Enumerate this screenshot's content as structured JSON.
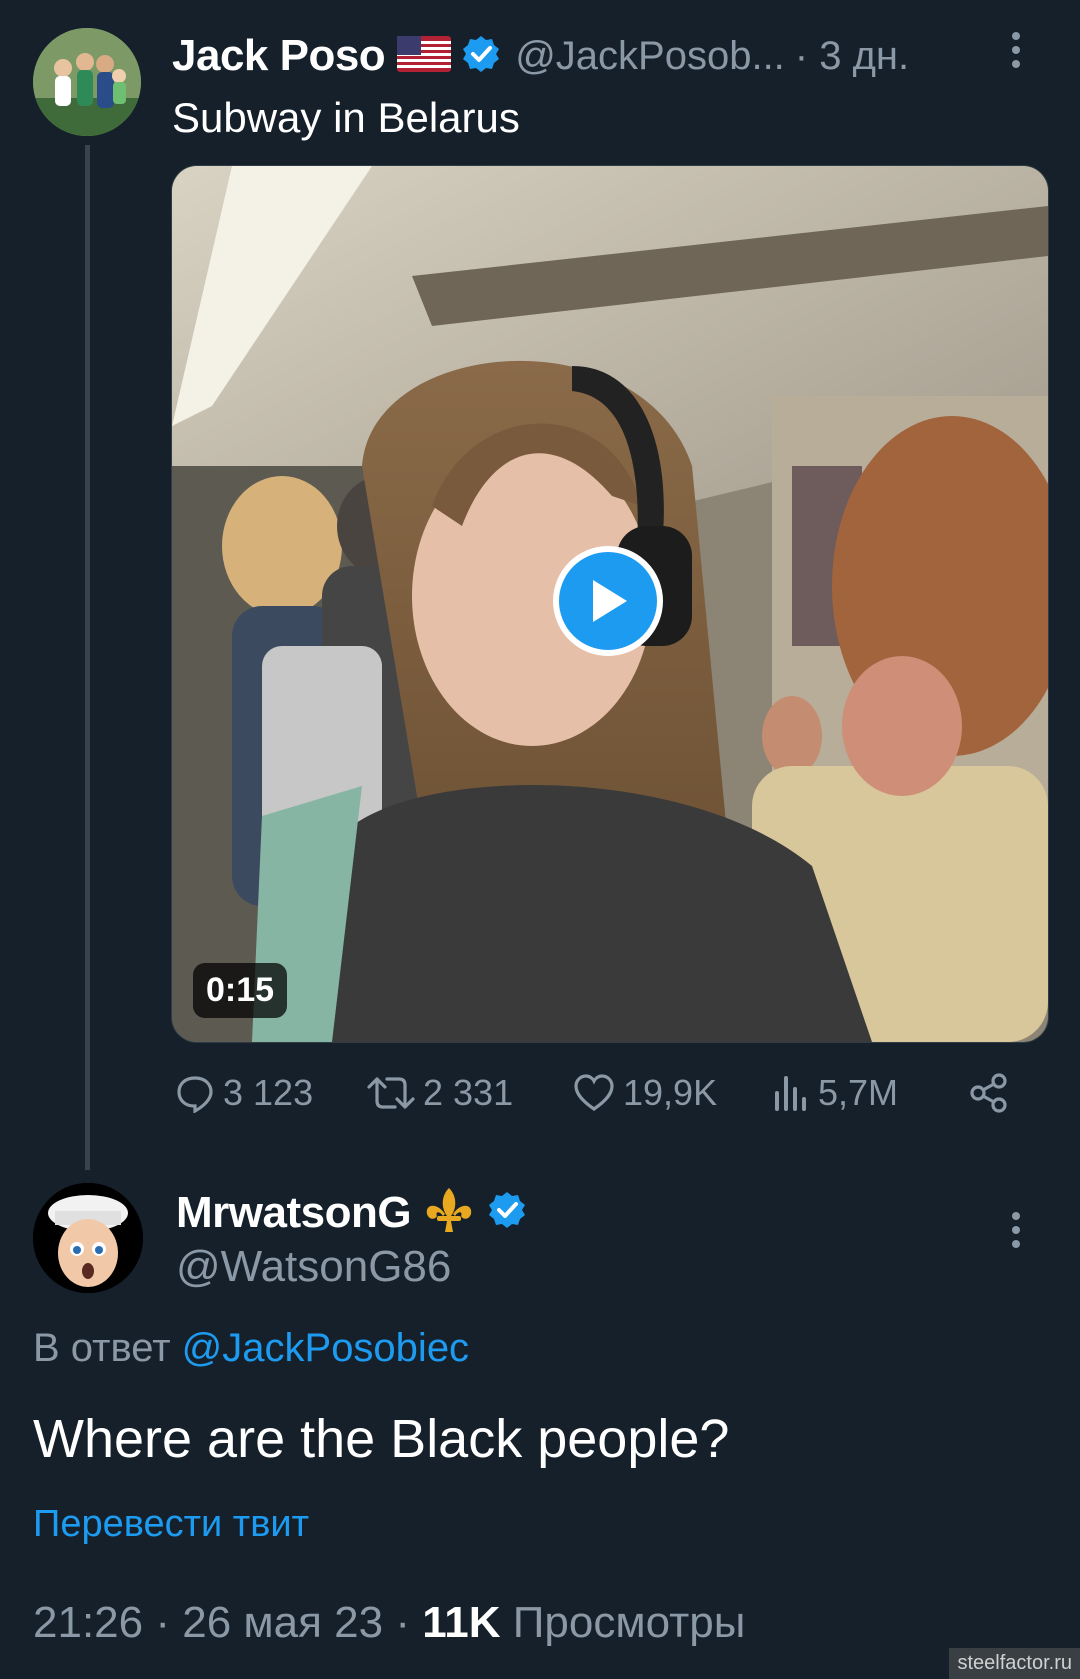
{
  "tweet": {
    "author_name": "Jack Poso",
    "author_handle": "@JackPosob...",
    "time": "· 3 дн.",
    "text": "Subway in Belarus",
    "flag_icon": "us-flag-icon",
    "video_duration": "0:15",
    "stats": {
      "replies": "3 123",
      "retweets": "2 331",
      "likes": "19,9K",
      "views": "5,7M"
    }
  },
  "reply": {
    "author_name": "MrwatsonG",
    "author_handle": "@WatsonG86",
    "reply_prefix": "В ответ",
    "reply_to": "@JackPosobiec",
    "text": "Where are the Black people?",
    "translate": "Перевести твит",
    "time": "21:26",
    "date": "26 мая 23",
    "views_count": "11K",
    "views_label": "Просмотры"
  },
  "watermark": "steelfactor.ru",
  "colors": {
    "background": "#15202b",
    "accent": "#1d9bf0",
    "muted": "#8b98a5"
  }
}
